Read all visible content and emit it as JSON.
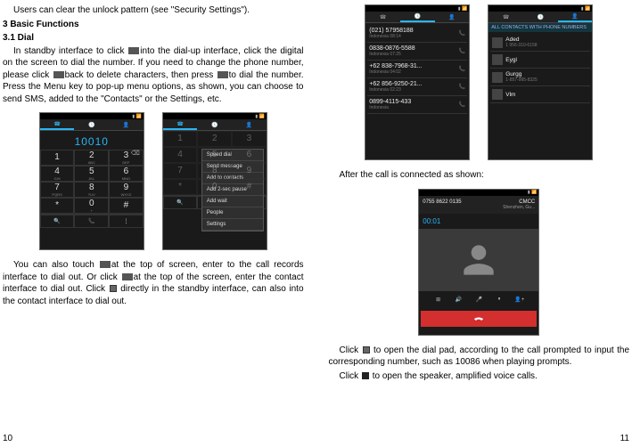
{
  "left": {
    "intro": "Users can clear the unlock pattern (see \"Security Settings\").",
    "heading_basic": "3  Basic Functions",
    "heading_dial": "3.1 Dial",
    "para1_a": "In standby interface to click",
    "para1_b": "into the dial-up interface, click the digital on the screen to dial the number. If you need to change the phone number, please click",
    "para1_c": "back to delete characters, then press",
    "para1_d": "to dial the number. Press the Menu key to pop-up menu options, as shown, you can choose to send SMS, added to the \"Contacts\" or the Settings, etc.",
    "para2_a": "You can also touch",
    "para2_b": "at the top of screen, enter to the call records interface to dial out. Or click",
    "para2_c": "at the top of the screen, enter the contact interface to dial out. Click",
    "para2_d": " directly in the standby interface, can also into the contact interface to dial out.",
    "dial_number": "10010",
    "menu": [
      "Speed dial",
      "Send message",
      "Add to contacts",
      "Add 2-sec pause",
      "Add wait",
      "People",
      "Settings"
    ],
    "keys": [
      {
        "n": "1",
        "l": ""
      },
      {
        "n": "2",
        "l": "ABC"
      },
      {
        "n": "3",
        "l": "DEF"
      },
      {
        "n": "4",
        "l": "GHI"
      },
      {
        "n": "5",
        "l": "JKL"
      },
      {
        "n": "6",
        "l": "MNO"
      },
      {
        "n": "7",
        "l": "PQRS"
      },
      {
        "n": "8",
        "l": "TUV"
      },
      {
        "n": "9",
        "l": "WXYZ"
      },
      {
        "n": "*",
        "l": ""
      },
      {
        "n": "0",
        "l": "+"
      },
      {
        "n": "#",
        "l": ""
      }
    ],
    "page": "10"
  },
  "right": {
    "after_call": "After the call is connected as shown:",
    "para3_a": "Click",
    "para3_b": "to open the dial pad, according to the call prompted to input the corresponding number, such as 10086 when playing prompts.",
    "para4_a": "Click",
    "para4_b": " to open the speaker, amplified voice calls.",
    "log_entries": [
      {
        "num": "(021) 57958188",
        "sub": "Indonesia",
        "t": "08:14"
      },
      {
        "num": "0838-0876-5588",
        "sub": "Indonesia",
        "t": "07:25"
      },
      {
        "num": "+62 838-7968-31...",
        "sub": "Indonesia",
        "t": "04:02"
      },
      {
        "num": "+62 856-9250-21...",
        "sub": "Indonesia",
        "t": "02:23"
      },
      {
        "num": "0899-4115-433",
        "sub": "Indonesia",
        "t": ""
      }
    ],
    "contacts_header": "ALL CONTACTS WITH PHONE NUMBERS",
    "contacts": [
      {
        "name": "Aded",
        "sub": "1 956-310-6158"
      },
      {
        "name": "Eygl",
        "sub": ""
      },
      {
        "name": "Gurgg",
        "sub": "1-857-995-8325"
      },
      {
        "name": "Vlm",
        "sub": ""
      }
    ],
    "incall": {
      "number": "0755 8622 0135",
      "carrier": "CMCC",
      "city": "Shenzhen, Gu...",
      "timer": "00:01"
    },
    "page": "11"
  }
}
